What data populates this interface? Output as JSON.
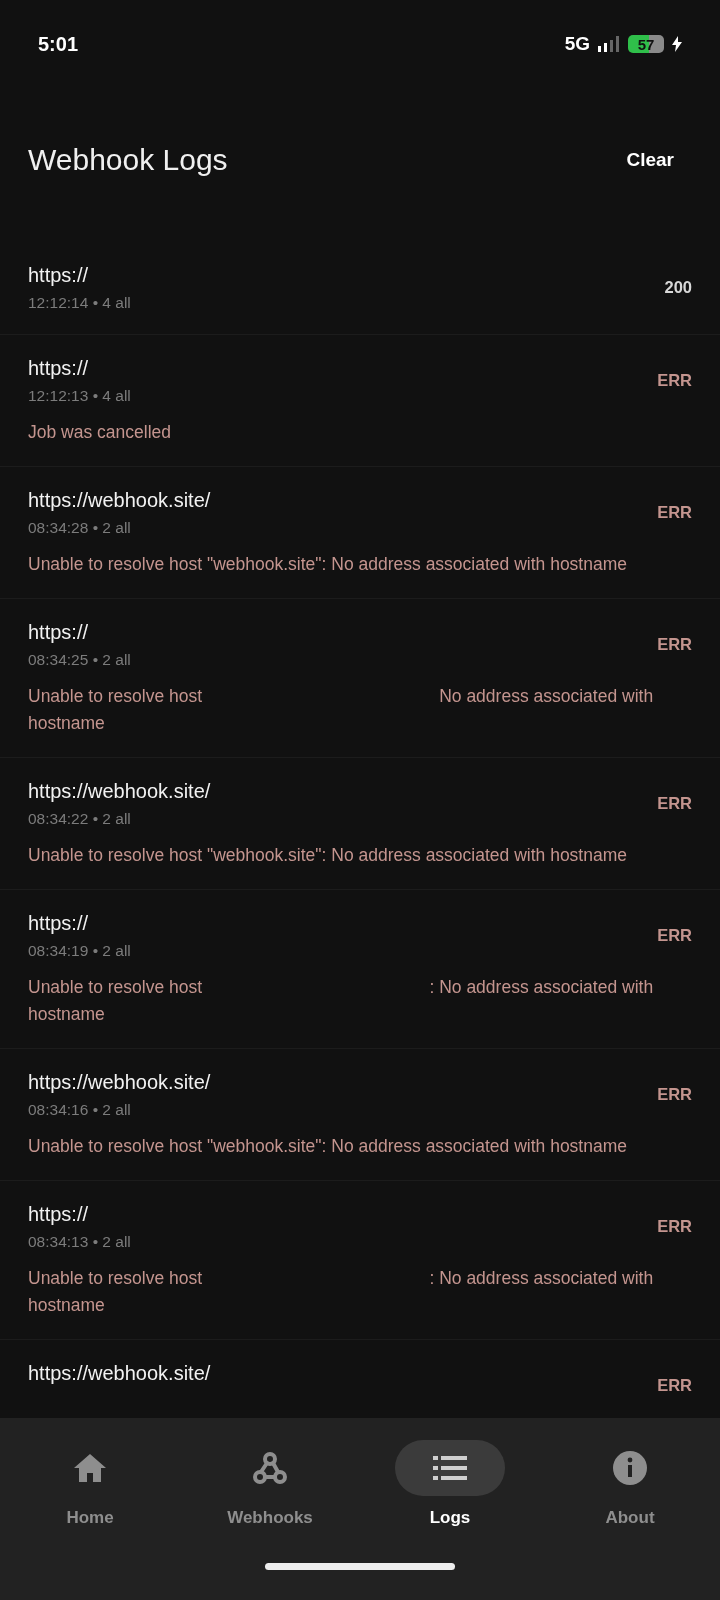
{
  "status_bar": {
    "time": "5:01",
    "network": "5G",
    "battery": "57"
  },
  "header": {
    "title": "Webhook Logs",
    "action": "Clear"
  },
  "logs": [
    {
      "url": "https://",
      "meta": "12:12:14 • 4 all",
      "status": "200",
      "kind": "ok"
    },
    {
      "url": "https://",
      "meta": "12:12:13 • 4 all",
      "status": "ERR",
      "kind": "error",
      "error_lines": [
        [
          "Job was cancelled"
        ]
      ]
    },
    {
      "url": "https://webhook.site/",
      "meta": "08:34:28 • 2 all",
      "status": "ERR",
      "kind": "error",
      "error_lines": [
        [
          "Unable to resolve host \"webhook.site\": No address associated with hostname"
        ]
      ]
    },
    {
      "url": "https://",
      "meta": "08:34:25 • 2 all",
      "status": "ERR",
      "kind": "error",
      "error_lines": [
        [
          "Unable to resolve host",
          "No address associated with"
        ],
        [
          "hostname"
        ]
      ]
    },
    {
      "url": "https://webhook.site/",
      "meta": "08:34:22 • 2 all",
      "status": "ERR",
      "kind": "error",
      "error_lines": [
        [
          "Unable to resolve host \"webhook.site\": No address associated with hostname"
        ]
      ]
    },
    {
      "url": "https://",
      "meta": "08:34:19 • 2 all",
      "status": "ERR",
      "kind": "error",
      "error_lines": [
        [
          "Unable to resolve host",
          ": No address associated with"
        ],
        [
          "hostname"
        ]
      ]
    },
    {
      "url": "https://webhook.site/",
      "meta": "08:34:16 • 2 all",
      "status": "ERR",
      "kind": "error",
      "error_lines": [
        [
          "Unable to resolve host \"webhook.site\": No address associated with hostname"
        ]
      ]
    },
    {
      "url": "https://",
      "meta": "08:34:13 • 2 all",
      "status": "ERR",
      "kind": "error",
      "error_lines": [
        [
          "Unable to resolve host",
          ": No address associated with"
        ],
        [
          "hostname"
        ]
      ]
    },
    {
      "url": "https://webhook.site/",
      "status": "ERR",
      "kind": "error"
    }
  ],
  "nav": [
    {
      "label": "Home",
      "kind": "home",
      "selected": false
    },
    {
      "label": "Webhooks",
      "kind": "webhook",
      "selected": false
    },
    {
      "label": "Logs",
      "kind": "list",
      "selected": true
    },
    {
      "label": "About",
      "kind": "info",
      "selected": false
    }
  ]
}
